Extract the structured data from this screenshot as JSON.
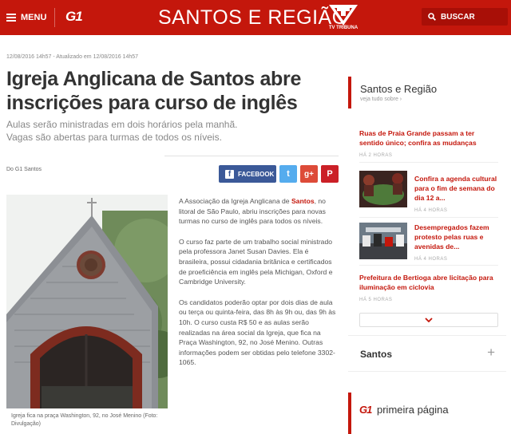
{
  "header": {
    "menu_label": "MENU",
    "g1_logo": "G1",
    "section_title": "SANTOS E REGIÃO",
    "tv_logo_text": "TV TRIBUNA",
    "search_label": "BUSCAR"
  },
  "article": {
    "dateline": "12/08/2016 14h57 - Atualizado em 12/08/2016 14h57",
    "headline": "Igreja Anglicana de Santos abre inscrições para curso de inglês",
    "subhead_1": "Aulas serão ministradas em dois horários pela manhã.",
    "subhead_2": "Vagas são abertas para turmas de todos os níveis.",
    "source": "Do G1 Santos",
    "share": {
      "facebook_label": "FACEBOOK",
      "twitter_glyph": "t",
      "googleplus_glyph": "g+",
      "pinterest_glyph": "P"
    },
    "photo_caption": "Igreja fica na praça Washington, 92, no José Menino (Foto: Divulgação)",
    "p1_before": "A Associação da Igreja Anglicana de ",
    "p1_link": "Santos",
    "p1_after": ", no litoral de São Paulo, abriu inscrições para novas turmas no curso de inglês para todos os níveis.",
    "p2": "O curso faz parte de um trabalho social ministrado pela professora Janet Susan Davies. Ela é brasileira, possui cidadania britânica e certificados de proeficiência em inglês pela Michigan, Oxford e Cambridge University.",
    "p3": "Os candidatos poderão optar por dois dias de aula ou terça ou quinta-feira, das 8h às 9h ou, das 9h às 10h. O curso custa R$ 50 e as aulas serão realizadas na área social da Igreja, que fica na Praça Washington, 92, no José Menino. Outras informações podem ser obtidas pelo telefone 3302-1065."
  },
  "sidebar": {
    "title": "Santos e Região",
    "more_link": "veja tudo sobre ›",
    "items": [
      {
        "title": "Ruas de Praia Grande passam a ter sentido único; confira as mudanças",
        "time": "HÁ 2 HORAS"
      },
      {
        "title": "Confira a agenda cultural para o fim de semana do dia 12 a...",
        "time": "HÁ 4 HORAS"
      },
      {
        "title": "Desempregados fazem protesto pelas ruas e avenidas de...",
        "time": "HÁ 4 HORAS"
      },
      {
        "title": "Prefeitura de Bertioga abre licitação para iluminação em ciclovia",
        "time": "HÁ 5 HORAS"
      }
    ],
    "accordion_title": "Santos",
    "accordion_plus": "+",
    "primeira_g1": "G1",
    "primeira_title": "primeira página"
  },
  "colors": {
    "brand_red": "#c4170c",
    "facebook": "#3b5998",
    "twitter": "#55acee",
    "googleplus": "#dd4b39",
    "pinterest": "#cb2027"
  }
}
